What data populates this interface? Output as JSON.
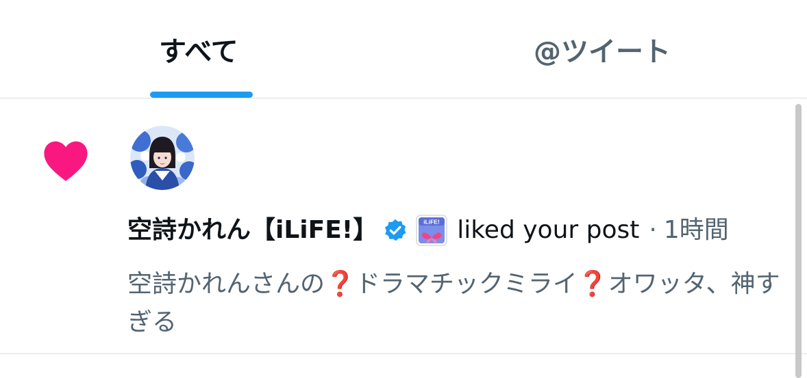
{
  "tabs": [
    {
      "label": "すべて",
      "active": true
    },
    {
      "label": "@ツイート",
      "active": false
    }
  ],
  "notification": {
    "type_icon": "heart-icon",
    "icon_color": "#f91880",
    "user_name": "空詩かれん【iLiFE!】",
    "verified_icon": "verified-badge-icon",
    "verified_color": "#1d9bf0",
    "affiliate_badge_text": "iLiFE!",
    "action": "liked your post",
    "separator": "·",
    "timestamp": "1時間",
    "post_text_part1": "空詩かれんさんの",
    "post_text_part2": "ドラマチックミライ",
    "post_text_part3": "オワッタ、神すぎる",
    "question_glyph": "❓"
  },
  "colors": {
    "accent": "#1d9bf0",
    "primary_text": "#0f1419",
    "secondary_text": "#536471",
    "like": "#f91880"
  }
}
